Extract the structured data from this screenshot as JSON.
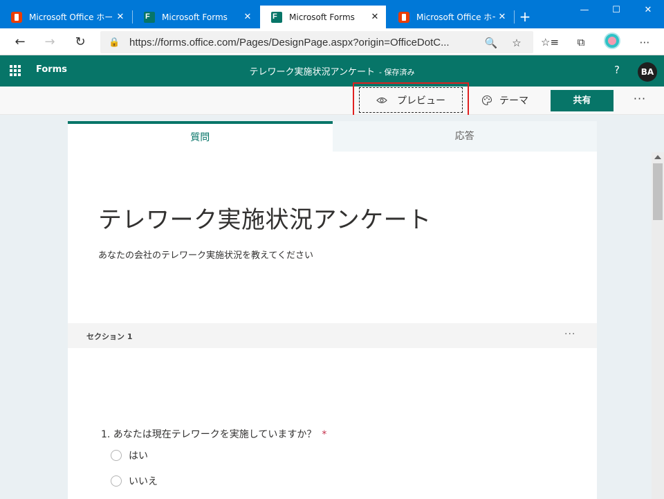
{
  "browser": {
    "tabs": [
      {
        "title": "Microsoft Office ホーム",
        "icon": "office-logo",
        "active": false
      },
      {
        "title": "Microsoft Forms",
        "icon": "forms-logo",
        "active": false
      },
      {
        "title": "Microsoft Forms",
        "icon": "forms-logo",
        "active": true
      },
      {
        "title": "Microsoft Office ホーム",
        "icon": "office-logo",
        "active": false
      }
    ],
    "close_glyph": "✕",
    "new_tab_glyph": "+",
    "window_controls": {
      "minimize": "—",
      "maximize": "☐",
      "close": "✕"
    },
    "url": "https://forms.office.com/Pages/DesignPage.aspx?origin=OfficeDotC...",
    "nav": {
      "back": "←",
      "forward": "→",
      "refresh": "↻"
    },
    "icons": {
      "lock": "🔒",
      "zoom": "🔍",
      "favorite": "☆",
      "favorites": "☆≡",
      "collections": "⧉",
      "more": "⋯"
    }
  },
  "header": {
    "app_name": "Forms",
    "doc_title": "テレワーク実施状況アンケート",
    "saved_status": "- 保存済み",
    "help": "?",
    "avatar_initials": "BA"
  },
  "toolbar": {
    "preview_label": "プレビュー",
    "theme_label": "テーマ",
    "share_label": "共有",
    "more": "···"
  },
  "form": {
    "tabs": [
      {
        "label": "質問",
        "active": true
      },
      {
        "label": "応答",
        "active": false
      }
    ],
    "title": "テレワーク実施状況アンケート",
    "description": "あなたの会社のテレワーク実施状況を教えてください",
    "section_label": "セクション 1",
    "section_more": "···",
    "question": {
      "text": "1. あなたは現在テレワークを実施していますか？",
      "required_mark": "*",
      "options": [
        "はい",
        "いいえ"
      ]
    }
  },
  "colors": {
    "browser_blue": "#0078d7",
    "forms_teal": "#077568",
    "highlight_red": "#e02020"
  }
}
